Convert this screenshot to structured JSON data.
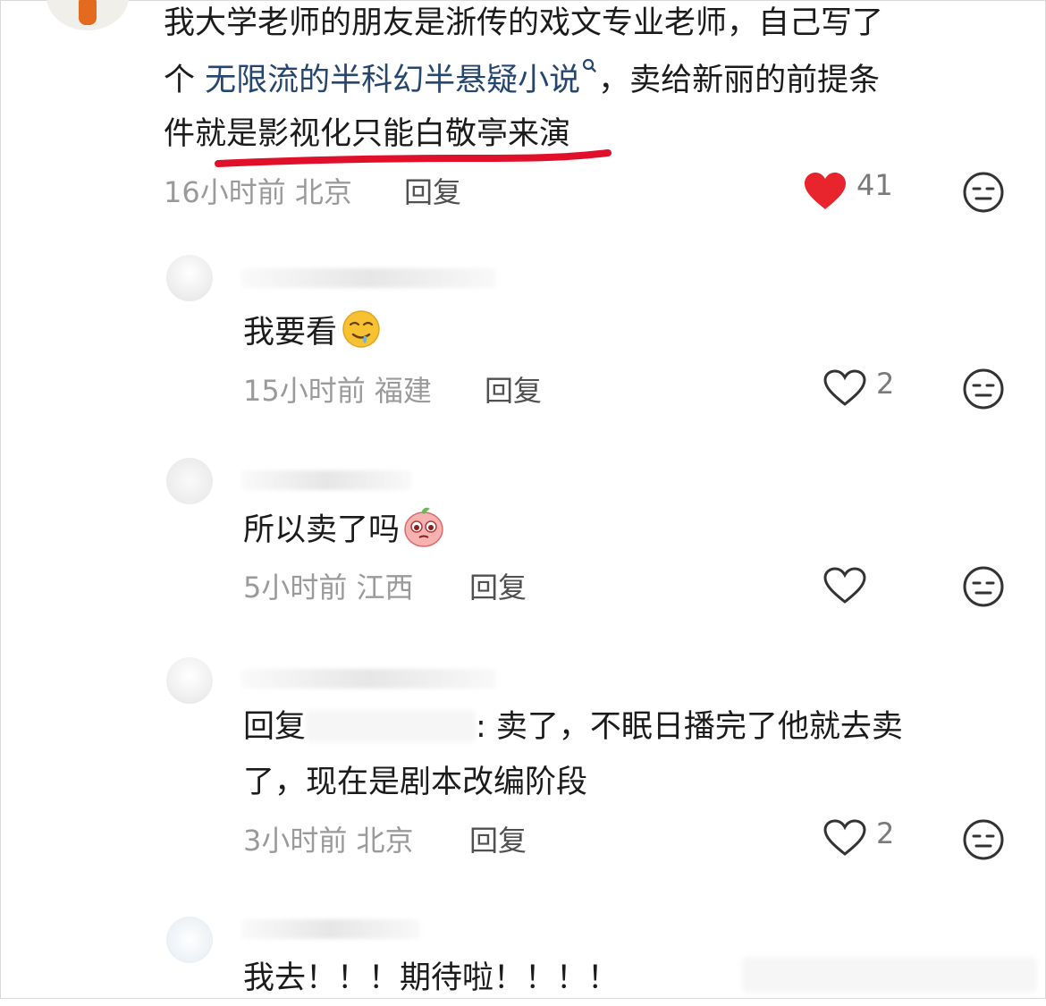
{
  "comment_main": {
    "line1": "我大学老师的朋友是浙传的戏文专业老师，自己写了",
    "line2_pre": "个 ",
    "line2_link": "无限流的半科幻半悬疑小说",
    "line2_post": "，卖给新丽的前提条",
    "line3_pre": "件就",
    "line3_highlight": "是影视化只能白敬亭来演",
    "time_location": "16小时前 北京",
    "reply_label": "回复",
    "like_count": "41",
    "like_state": "liked",
    "like_color": "#e8242c"
  },
  "replies": [
    {
      "text": "我要看",
      "emoji": "drooling-face",
      "time_location": "15小时前 福建",
      "reply_label": "回复",
      "like_count": "2"
    },
    {
      "text": "所以卖了吗",
      "emoji": "pleading-peach",
      "time_location": "5小时前 江西",
      "reply_label": "回复",
      "like_count": ""
    },
    {
      "text_pre": "回复",
      "text_post": ": 卖了，不眠日播完了他就去卖",
      "text_line2": "了，现在是剧本改编阶段",
      "time_location": "3小时前 北京",
      "reply_label": "回复",
      "like_count": "2"
    },
    {
      "text": "我去！！！期待啦！！！！"
    }
  ],
  "colors": {
    "highlight_underline": "#e0102a",
    "link": "#25466e",
    "meta": "#9a9a9a"
  }
}
